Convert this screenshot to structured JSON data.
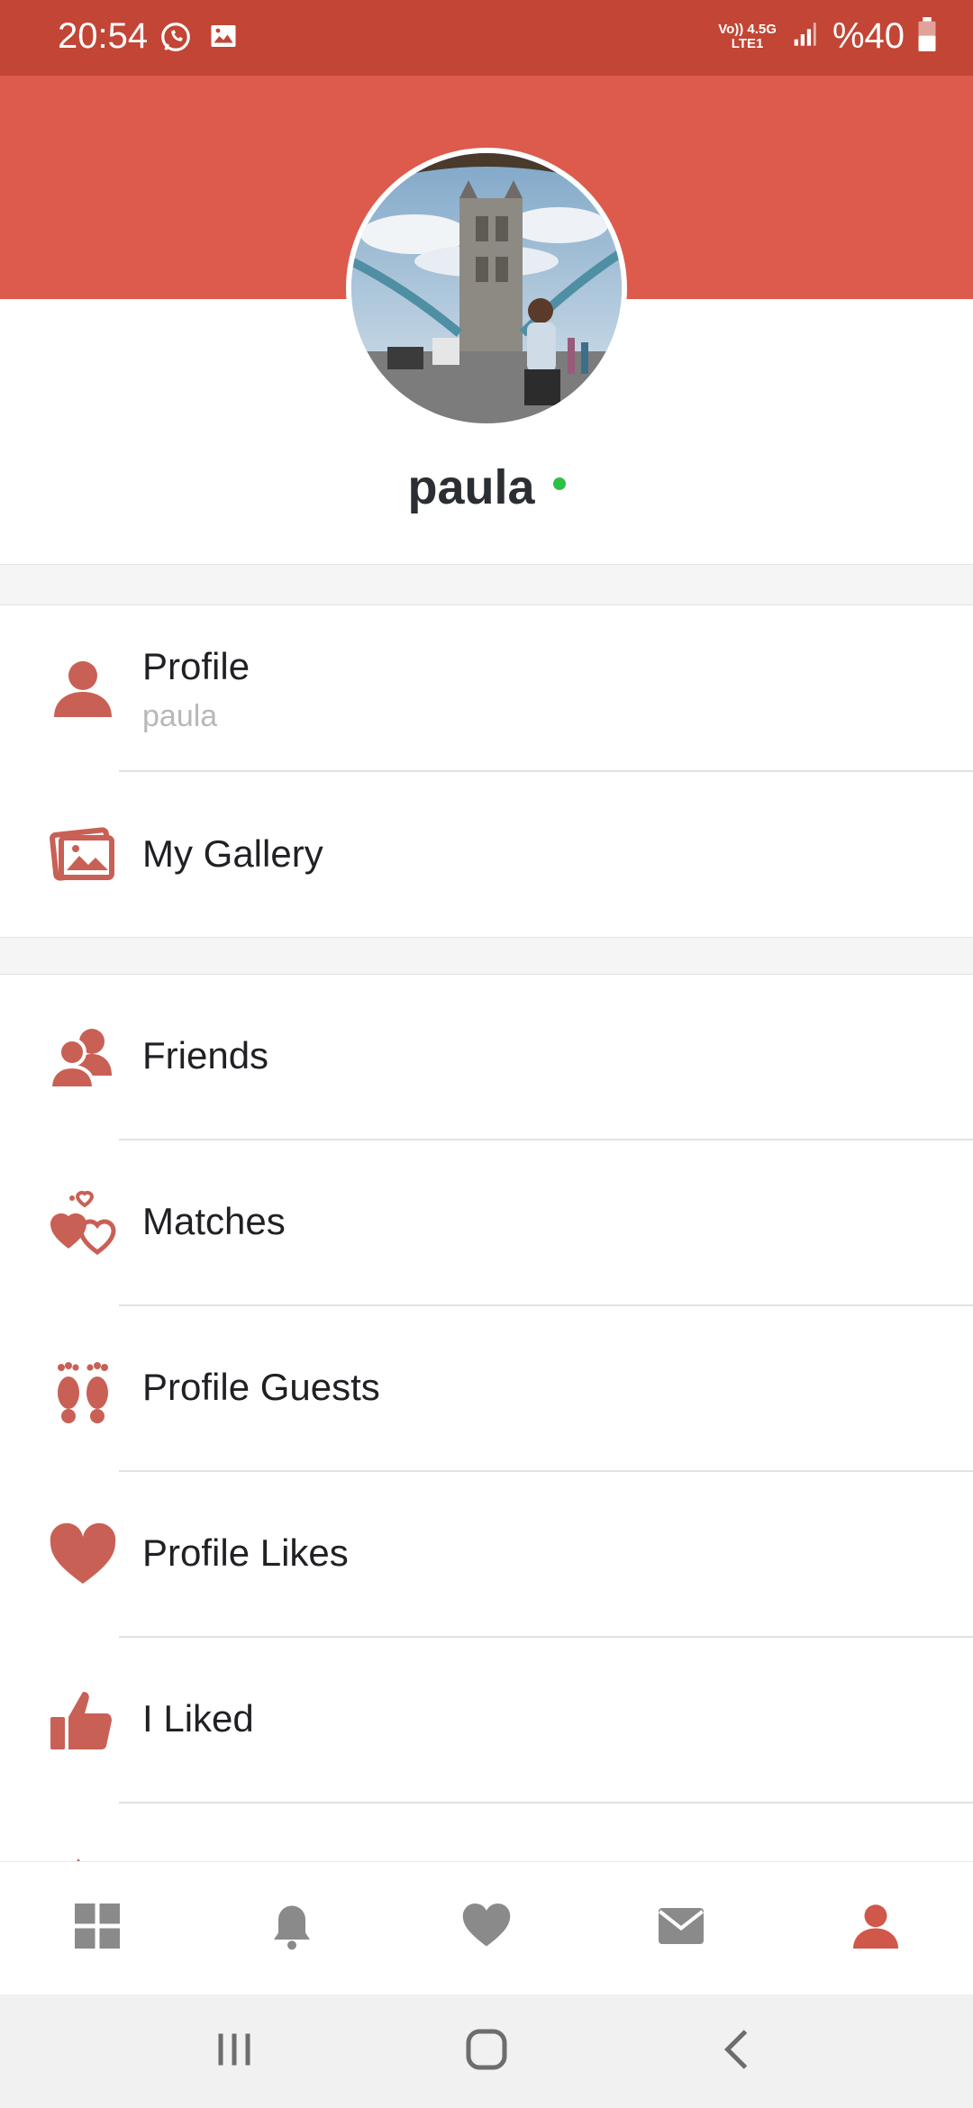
{
  "status_bar": {
    "time": "20:54",
    "network_label_top": "Vo)) 4.5G",
    "network_label_bottom": "LTE1",
    "battery": "%40",
    "icons": [
      "whatsapp-icon",
      "image-icon",
      "volte-icon",
      "signal-icon",
      "battery-icon"
    ]
  },
  "profile": {
    "username": "paula",
    "online": true
  },
  "menu": {
    "section1": [
      {
        "label": "Profile",
        "sub": "paula",
        "icon": "person-icon"
      },
      {
        "label": "My Gallery",
        "icon": "gallery-icon"
      }
    ],
    "section2": [
      {
        "label": "Friends",
        "icon": "friends-icon"
      },
      {
        "label": "Matches",
        "icon": "matches-hearts-icon"
      },
      {
        "label": "Profile Guests",
        "icon": "footprints-icon"
      },
      {
        "label": "Profile Likes",
        "icon": "heart-icon"
      },
      {
        "label": "I Liked",
        "icon": "thumbs-up-icon"
      }
    ]
  },
  "bottom_nav": [
    "grid-icon",
    "bell-icon",
    "heart-icon",
    "mail-icon",
    "person-icon"
  ],
  "colors": {
    "accent": "#dc5b4c",
    "status_bar": "#c24535",
    "icon_color": "#c96055",
    "online": "#2fbf45",
    "nav_inactive": "#8a8a8a"
  }
}
